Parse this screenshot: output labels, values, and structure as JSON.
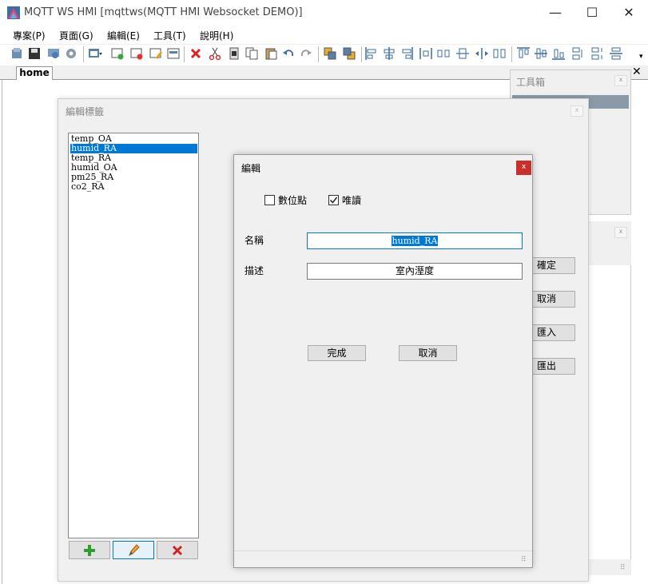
{
  "window": {
    "title": "MQTT WS HMI [mqttws(MQTT HMI Websocket DEMO)]",
    "minimize": "—",
    "maximize": "☐",
    "close": "✕"
  },
  "menu": [
    "專案(P)",
    "頁面(G)",
    "編輯(E)",
    "工具(T)",
    "說明(H)"
  ],
  "tabs": [
    {
      "label": "home"
    }
  ],
  "tab_close": "✕",
  "toolbox": {
    "title": "工具箱",
    "close": "x"
  },
  "tag_dialog": {
    "title": "編輯標籤",
    "close": "x",
    "tags": [
      "temp_OA",
      "humid_RA",
      "temp_RA",
      "humid_OA",
      "pm25_RA",
      "co2_RA"
    ],
    "selected_index": 1,
    "side_buttons": [
      "確定",
      "取消",
      "匯入",
      "匯出"
    ]
  },
  "edit_dialog": {
    "title": "編輯",
    "close": "x",
    "checkbox_digital": {
      "label": "數位點",
      "checked": false
    },
    "checkbox_readonly": {
      "label": "唯讀",
      "checked": true
    },
    "name_label": "名稱",
    "name_value": "humid_RA",
    "desc_label": "描述",
    "desc_value": "室內溼度",
    "ok_label": "完成",
    "cancel_label": "取消"
  },
  "colors": {
    "accent": "#0078d7",
    "close_red": "#c9302c",
    "add_green": "#2e9e2e",
    "delete_red": "#d22222"
  }
}
